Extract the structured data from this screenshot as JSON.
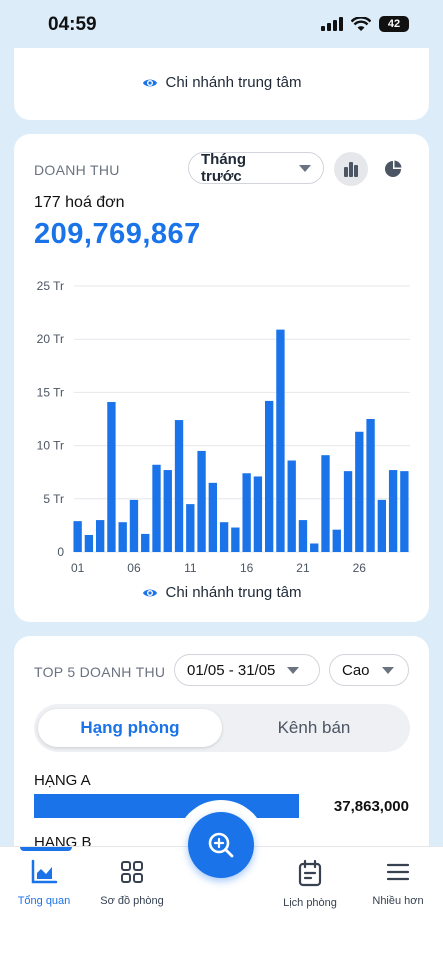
{
  "status_bar": {
    "time": "04:59",
    "battery": "42"
  },
  "card1": {
    "branch": "Chi nhánh trung tâm"
  },
  "revenue": {
    "title": "DOANH THU",
    "period": "Tháng trước",
    "invoice_count": "177 hoá đơn",
    "total": "209,769,867",
    "branch": "Chi nhánh trung tâm",
    "icons": {
      "bar_chart": "bar-chart-icon",
      "pie_chart": "pie-chart-icon",
      "eye": "eye-icon"
    }
  },
  "chart_data": {
    "type": "bar",
    "x": [
      1,
      2,
      3,
      4,
      5,
      6,
      7,
      8,
      9,
      10,
      11,
      12,
      13,
      14,
      15,
      16,
      17,
      18,
      19,
      20,
      21,
      22,
      23,
      24,
      25,
      26,
      27,
      28,
      29,
      30
    ],
    "values": [
      2.9,
      1.6,
      3.0,
      14.1,
      2.8,
      4.9,
      1.7,
      8.2,
      7.7,
      12.4,
      4.5,
      9.5,
      6.5,
      2.8,
      2.3,
      7.4,
      7.1,
      14.2,
      20.9,
      8.6,
      3.0,
      0.8,
      9.1,
      2.1,
      7.6,
      11.3,
      12.5,
      4.9,
      7.7,
      7.6
    ],
    "x_tick_labels": [
      "01",
      "06",
      "11",
      "16",
      "21",
      "26"
    ],
    "x_tick_positions": [
      1,
      6,
      11,
      16,
      21,
      26
    ],
    "y_ticks": [
      "0",
      "5 Tr",
      "10 Tr",
      "15 Tr",
      "20 Tr",
      "25 Tr"
    ],
    "y_tick_values": [
      0,
      5,
      10,
      15,
      20,
      25
    ],
    "ylim": [
      0,
      25
    ],
    "grid": true,
    "color": "#1a73e8"
  },
  "top5": {
    "title": "TOP 5 DOANH THU",
    "date_range": "01/05 - 31/05",
    "sort": "Cao",
    "tabs": [
      "Hạng phòng",
      "Kênh bán"
    ],
    "items": [
      {
        "label": "HẠNG A",
        "value": "37,863,000",
        "fraction": 1.0
      },
      {
        "label": "HẠNG B",
        "value": ""
      }
    ]
  },
  "nav": {
    "items": [
      "Tổng quan",
      "Sơ đồ phòng",
      "Lịch phòng",
      "Nhiều hơn"
    ],
    "active": "Tổng quan"
  },
  "colors": {
    "accent": "#1a73e8",
    "background": "#dcecf8"
  }
}
